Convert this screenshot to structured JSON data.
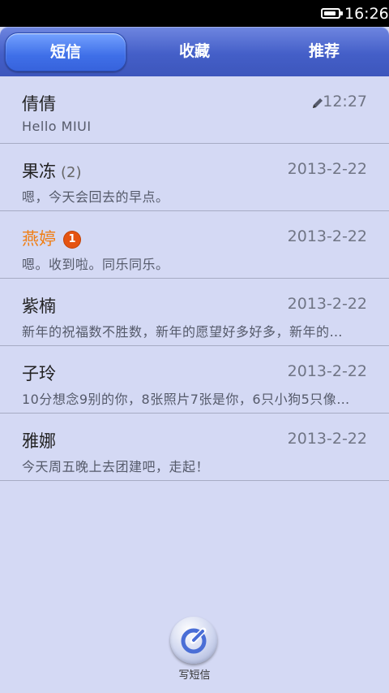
{
  "status_bar": {
    "time": "16:26",
    "battery_level": 0.9
  },
  "tabs": [
    {
      "label": "短信",
      "active": true
    },
    {
      "label": "收藏",
      "active": false
    },
    {
      "label": "推荐",
      "active": false
    }
  ],
  "conversations": [
    {
      "name": "倩倩",
      "count": "",
      "date": "12:27",
      "preview": "Hello MIUI",
      "draft": true,
      "unread": false,
      "unread_count": ""
    },
    {
      "name": "果冻",
      "count": "(2)",
      "date": "2013-2-22",
      "preview": "嗯，今天会回去的早点。",
      "draft": false,
      "unread": false,
      "unread_count": ""
    },
    {
      "name": "燕婷",
      "count": "",
      "date": "2013-2-22",
      "preview": "嗯。收到啦。同乐同乐。",
      "draft": false,
      "unread": true,
      "unread_count": "1"
    },
    {
      "name": "紫楠",
      "count": "",
      "date": "2013-2-22",
      "preview": "新年的祝福数不胜数，新年的愿望好多好多，新年的…",
      "draft": false,
      "unread": false,
      "unread_count": ""
    },
    {
      "name": "子玲",
      "count": "",
      "date": "2013-2-22",
      "preview": "10分想念9别的你，8张照片7张是你，6只小狗5只像…",
      "draft": false,
      "unread": false,
      "unread_count": ""
    },
    {
      "name": "雅娜",
      "count": "",
      "date": "2013-2-22",
      "preview": "今天周五晚上去团建吧，走起！",
      "draft": false,
      "unread": false,
      "unread_count": ""
    }
  ],
  "compose": {
    "label": "写短信"
  },
  "colors": {
    "accent": "#3f6fe8",
    "unread_name": "#f07e14",
    "badge": "#e55412",
    "background": "#d4d9f4"
  }
}
